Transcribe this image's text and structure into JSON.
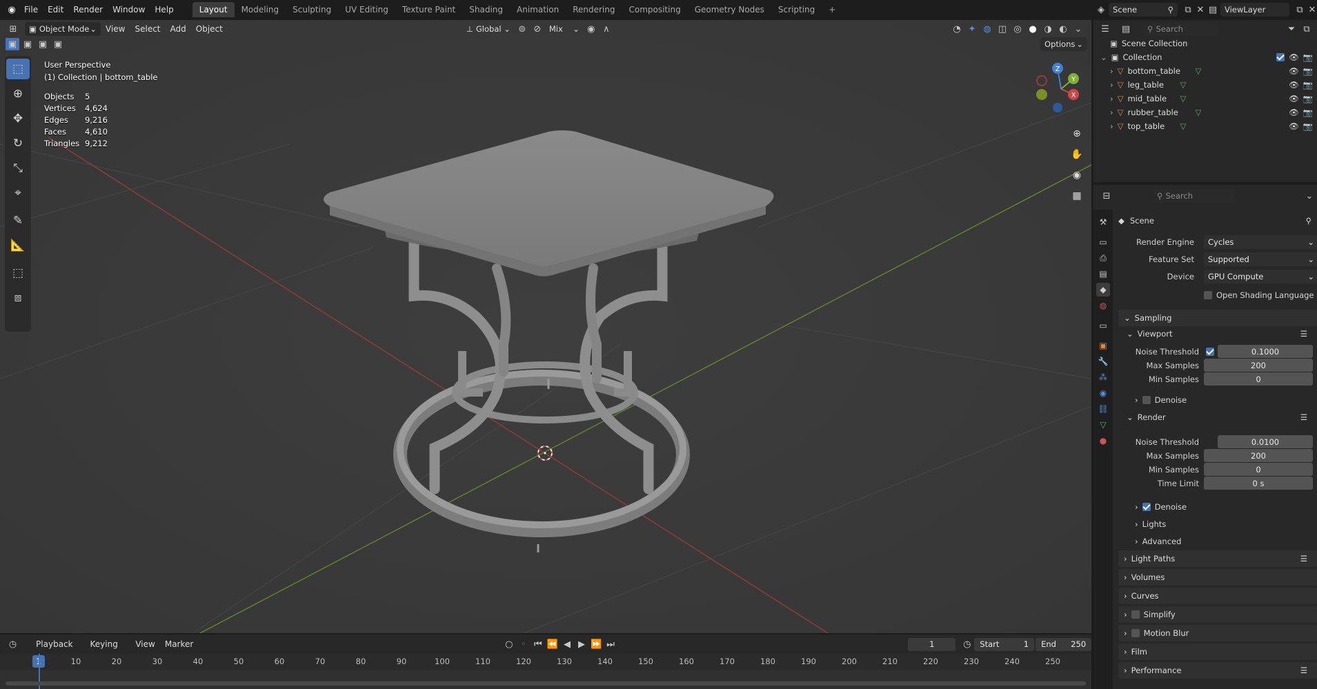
{
  "topbar": {
    "menus": [
      "File",
      "Edit",
      "Render",
      "Window",
      "Help"
    ],
    "workspaces": [
      "Layout",
      "Modeling",
      "Sculpting",
      "UV Editing",
      "Texture Paint",
      "Shading",
      "Animation",
      "Rendering",
      "Compositing",
      "Geometry Nodes",
      "Scripting"
    ],
    "active_workspace": "Layout",
    "add_tab": "+",
    "scene_name": "Scene",
    "viewlayer_name": "ViewLayer"
  },
  "viewport_header": {
    "mode": "Object Mode",
    "menus": [
      "View",
      "Select",
      "Add",
      "Object"
    ],
    "transform_orientation": "Global",
    "snap_mode": "Mix",
    "options": "Options"
  },
  "viewport": {
    "perspective": "User Perspective",
    "collection_label": "(1) Collection | bottom_table",
    "stats": [
      {
        "label": "Objects",
        "value": "5"
      },
      {
        "label": "Vertices",
        "value": "4,624"
      },
      {
        "label": "Edges",
        "value": "9,216"
      },
      {
        "label": "Faces",
        "value": "4,610"
      },
      {
        "label": "Triangles",
        "value": "9,212"
      }
    ],
    "gizmo_axes": {
      "x": "X",
      "y": "Y",
      "z": "Z"
    }
  },
  "outliner": {
    "search_placeholder": "Search",
    "root": "Scene Collection",
    "collection": "Collection",
    "objects": [
      "bottom_table",
      "leg_table",
      "mid_table",
      "rubber_table",
      "top_table"
    ]
  },
  "properties": {
    "search_placeholder": "Search",
    "context": "Scene",
    "render_engine": {
      "label": "Render Engine",
      "value": "Cycles"
    },
    "feature_set": {
      "label": "Feature Set",
      "value": "Supported"
    },
    "device": {
      "label": "Device",
      "value": "GPU Compute"
    },
    "osl": "Open Shading Language",
    "sampling": "Sampling",
    "viewport": {
      "title": "Viewport",
      "noise_threshold_label": "Noise Threshold",
      "noise_threshold": "0.1000",
      "max_samples_label": "Max Samples",
      "max_samples": "200",
      "min_samples_label": "Min Samples",
      "min_samples": "0",
      "denoise": "Denoise"
    },
    "render": {
      "title": "Render",
      "noise_threshold_label": "Noise Threshold",
      "noise_threshold": "0.0100",
      "max_samples_label": "Max Samples",
      "max_samples": "200",
      "min_samples_label": "Min Samples",
      "min_samples": "0",
      "time_limit_label": "Time Limit",
      "time_limit": "0 s",
      "denoise": "Denoise"
    },
    "subsections": [
      "Lights",
      "Advanced"
    ],
    "panels": [
      "Light Paths",
      "Volumes",
      "Curves",
      "Simplify",
      "Motion Blur",
      "Film",
      "Performance"
    ]
  },
  "timeline": {
    "menus": [
      "Playback",
      "Keying",
      "View",
      "Marker"
    ],
    "current_frame": "1",
    "start_label": "Start",
    "start": "1",
    "end_label": "End",
    "end": "250",
    "ticks": [
      "10",
      "20",
      "30",
      "40",
      "50",
      "60",
      "70",
      "80",
      "90",
      "100",
      "110",
      "120",
      "130",
      "140",
      "150",
      "160",
      "170",
      "180",
      "190",
      "200",
      "210",
      "220",
      "230",
      "240",
      "250"
    ],
    "playhead": "1"
  },
  "colors": {
    "accent": "#4772b3",
    "x_axis": "#9b3b3b",
    "y_axis": "#6b8a2a",
    "background": "#3b3b3b",
    "object_orange": "#e08a3c",
    "mesh_green": "#4fb26b"
  }
}
